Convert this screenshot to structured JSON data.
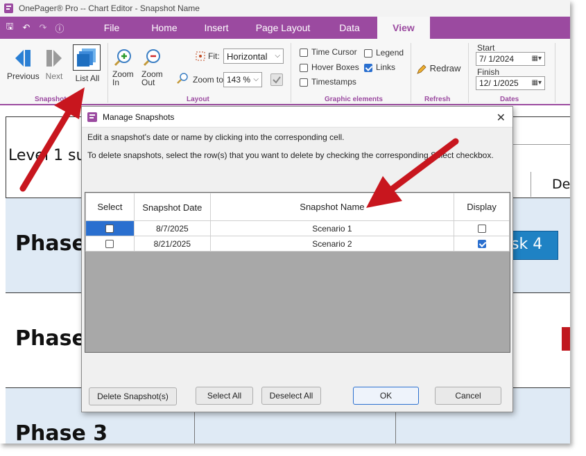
{
  "window": {
    "title": "OnePager® Pro --  Chart Editor - Snapshot Name"
  },
  "ribbon_tabs": [
    "File",
    "Home",
    "Insert",
    "Page Layout",
    "Data",
    "View"
  ],
  "ribbon": {
    "snapshots": {
      "previous": "Previous",
      "next": "Next",
      "list_all": "List All",
      "group": "Snapshots"
    },
    "layout": {
      "zoom_in": [
        "Zoom",
        "In"
      ],
      "zoom_out": [
        "Zoom",
        "Out"
      ],
      "fit_label": "Fit:",
      "fit_value": "Horizontal",
      "zoom_to_label": "Zoom to:",
      "zoom_to_value": "143 %",
      "group": "Layout"
    },
    "graphic_elements": {
      "time_cursor": "Time Cursor",
      "hover_boxes": "Hover Boxes",
      "timestamps": "Timestamps",
      "legend": "Legend",
      "links": "Links",
      "group": "Graphic elements"
    },
    "refresh": {
      "redraw": "Redraw",
      "group": "Refresh"
    },
    "dates": {
      "start_label": "Start",
      "start_value": "7/  1/2024",
      "finish_label": "Finish",
      "finish_value": "12/  1/2025",
      "group": "Dates"
    }
  },
  "chart": {
    "level_label": "Level 1 su",
    "right_header": "De",
    "phases": [
      "Phase",
      "Phase",
      "Phase 3"
    ],
    "task_label": "sk 4"
  },
  "dialog": {
    "title": "Manage Snapshots",
    "instruction1": "Edit a snapshot's date or name by clicking into the corresponding cell.",
    "instruction2": "To delete snapshots, select the row(s) that you want to delete by checking the corresponding Select checkbox.",
    "columns": {
      "select": "Select",
      "date": "Snapshot Date",
      "name": "Snapshot Name",
      "display": "Display"
    },
    "rows": [
      {
        "date": "8/7/2025",
        "name": "Scenario 1",
        "selected": false,
        "display": false
      },
      {
        "date": "8/21/2025",
        "name": "Scenario 2",
        "selected": false,
        "display": true
      }
    ],
    "buttons": {
      "delete": "Delete Snapshot(s)",
      "select_all": "Select All",
      "deselect_all": "Deselect All",
      "ok": "OK",
      "cancel": "Cancel"
    }
  },
  "colors": {
    "accent": "#9b4aa0",
    "arrow": "#c8161e",
    "task": "#1f82c4"
  }
}
